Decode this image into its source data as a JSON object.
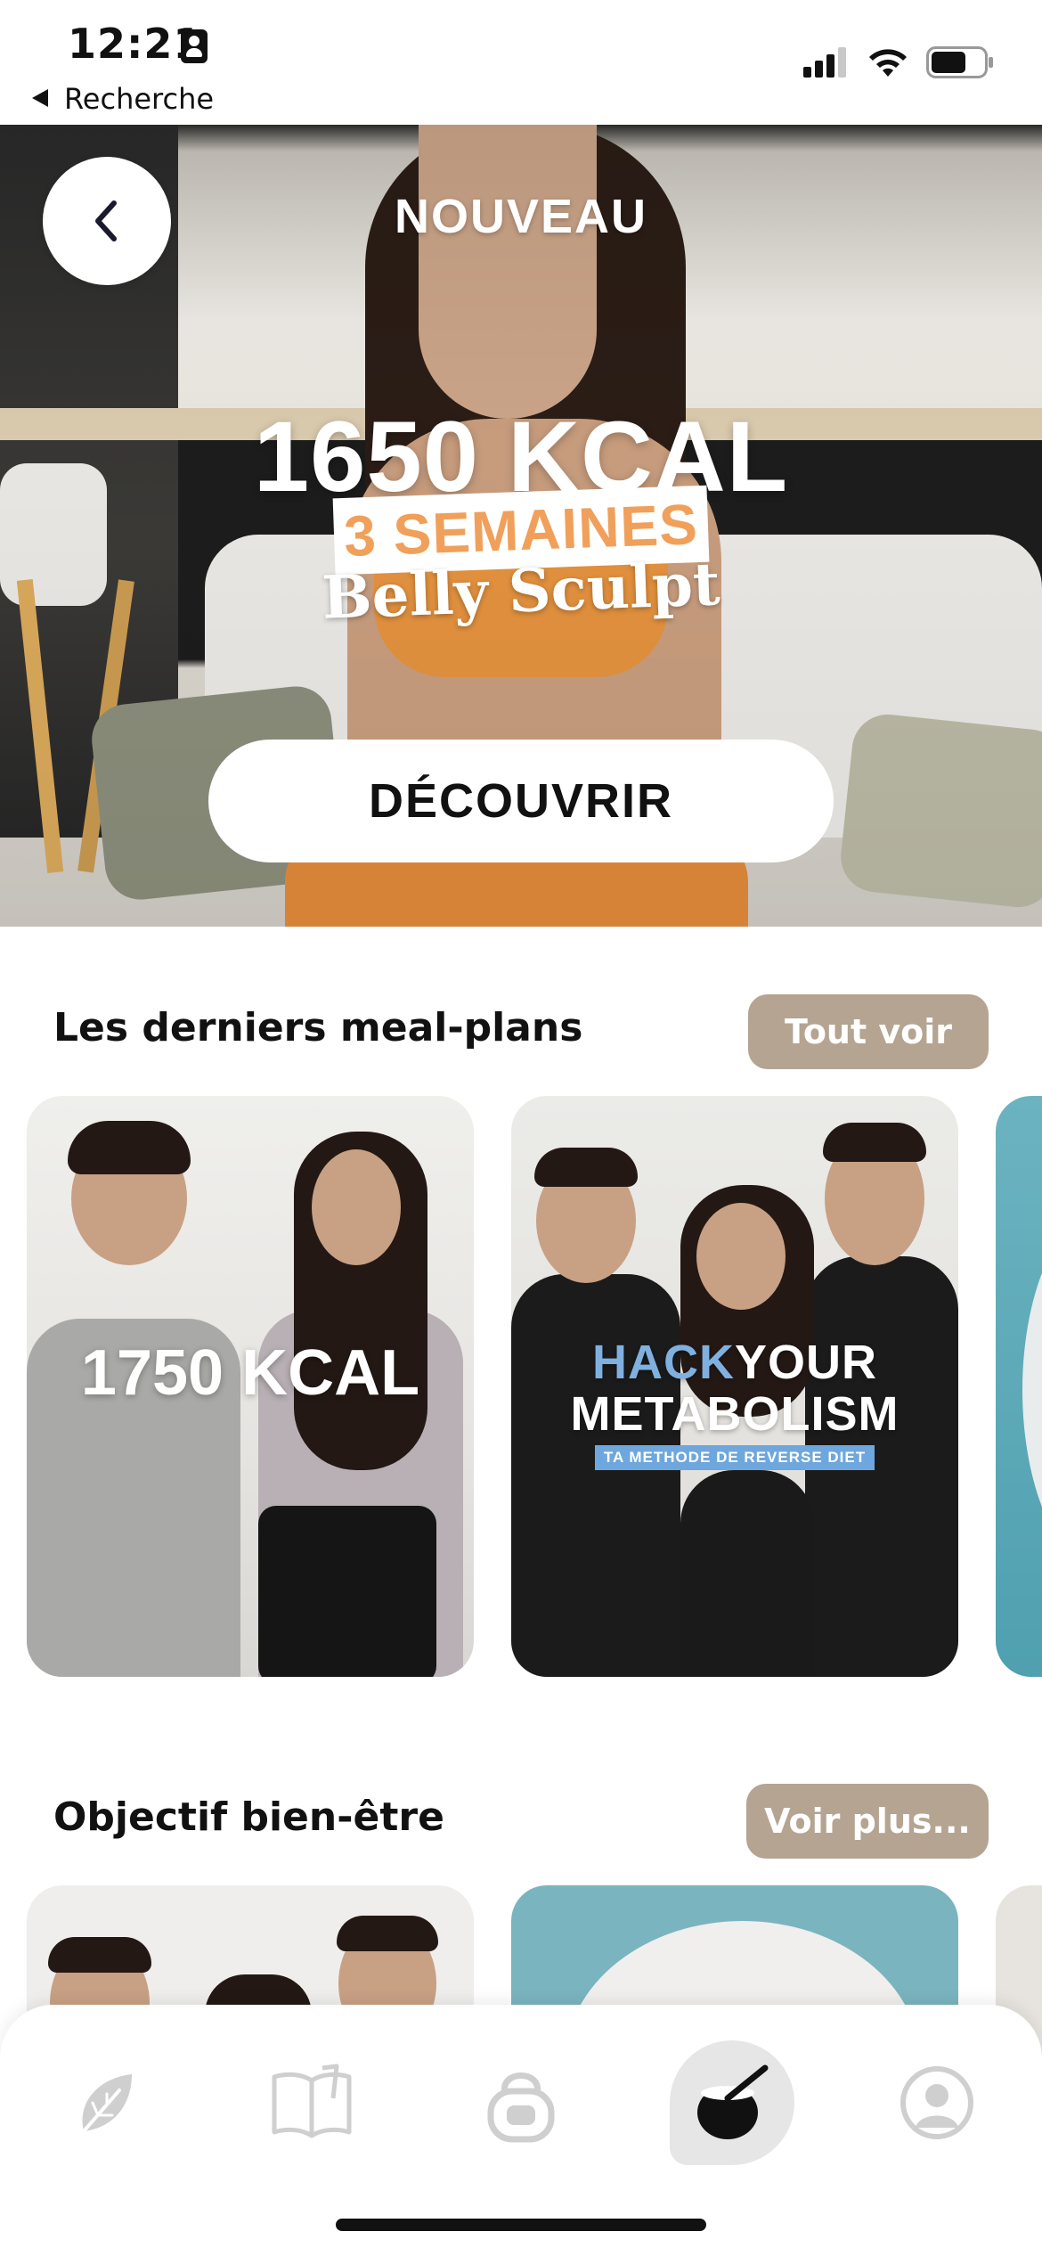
{
  "status_bar": {
    "time": "12:21",
    "back_app": "Recherche",
    "icons": [
      "signal-icon",
      "wifi-icon",
      "battery-icon"
    ]
  },
  "hero": {
    "tag": "NOUVEAU",
    "kcal": "1650 KCAL",
    "duration": "3 SEMAINES",
    "program": "Belly Sculpt",
    "cta": "DÉCOUVRIR"
  },
  "meal_plans": {
    "title": "Les derniers meal-plans",
    "see_all": "Tout voir",
    "cards": [
      {
        "title": "1750 KCAL"
      },
      {
        "hack": "HACK",
        "your": "YOUR",
        "metabolism": "METABOLISM",
        "subtitle": "TA METHODE DE REVERSE DIET"
      }
    ]
  },
  "wellbeing": {
    "title": "Objectif bien-être",
    "see_more": "Voir plus..."
  },
  "tab_bar": {
    "tabs": [
      "leaf-icon",
      "book-icon",
      "kettlebell-icon",
      "bowl-icon",
      "profile-icon"
    ],
    "active_index": 3
  },
  "colors": {
    "accent": "#b4a491",
    "orange": "#f0a05a",
    "blue": "#6ea7dd"
  }
}
